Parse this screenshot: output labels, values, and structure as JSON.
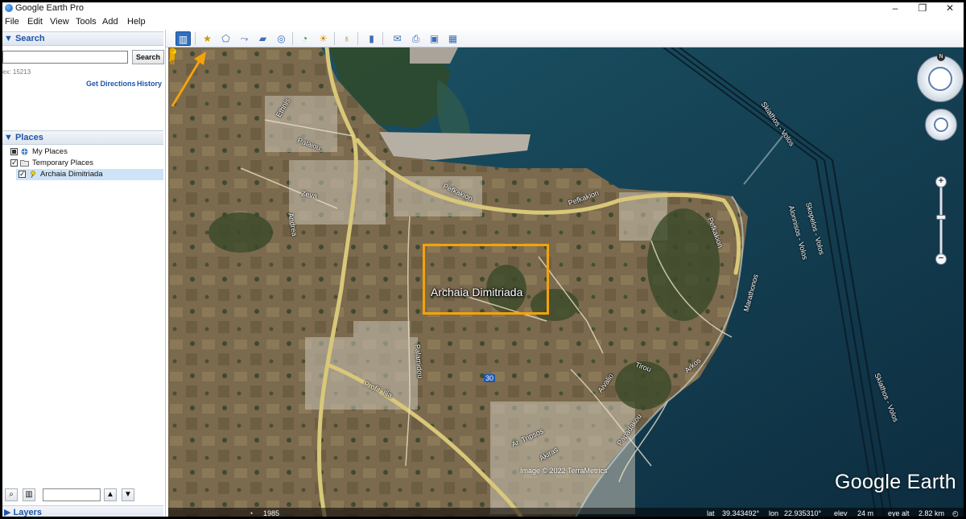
{
  "window": {
    "title": "Google Earth Pro",
    "minimize": "–",
    "maximize": "❐",
    "close": "✕"
  },
  "menu": [
    "File",
    "Edit",
    "View",
    "Tools",
    "Add",
    "Help"
  ],
  "search": {
    "header": "▼ Search",
    "input_value": "",
    "button": "Search",
    "hint": "ex: 15213",
    "get_directions": "Get Directions",
    "history": "History"
  },
  "places": {
    "header": "▼ Places",
    "items": [
      "My Places",
      "Temporary Places",
      "Archaia Dimitriada"
    ]
  },
  "layers": {
    "header": "▶ Layers"
  },
  "map": {
    "place_label": "Archaia Dimitriada",
    "road_labels": [
      "Pefkakion",
      "Pefkakion",
      "Pefkakion",
      "Zeva",
      "Andrea",
      "Palaiou",
      "Ethnis",
      "Palamidou",
      "Profit. Ilia",
      "Tirou",
      "Aivalio",
      "Papadakou",
      "Ar. Tripsos",
      "Akiras",
      "Arkos",
      "Marathonos"
    ],
    "route_badge": "30",
    "ferry_labels": [
      "Skiathos - Volos",
      "Skopelos - Volos",
      "Alonnisos - Volos",
      "Skiathos - Volos"
    ],
    "attribution": "Image © 2022 TerraMetrics",
    "brand": "Google Earth",
    "compass_north": "N"
  },
  "status": {
    "year": "1985",
    "lat_label": "lat",
    "lat": "39.343492°",
    "lon_label": "lon",
    "lon": "22.935310°",
    "elev_label": "elev",
    "elev": "24 m",
    "eye_label": "eye alt",
    "eye": "2.82 km"
  },
  "colors": {
    "panel_header_text": "#1f55a8",
    "highlight_box": "#f5a20a",
    "annotation_arrow": "#f5a20a",
    "sea": "#123f55",
    "land": "#7a6a4e"
  },
  "icons": [
    "sidebar-toggle-icon",
    "placemark-icon",
    "polygon-icon",
    "path-icon",
    "image-overlay-icon",
    "record-tour-icon",
    "historical-imagery-icon",
    "sunlight-icon",
    "planets-icon",
    "ruler-icon",
    "email-icon",
    "print-icon",
    "save-image-icon",
    "view-in-maps-icon"
  ]
}
